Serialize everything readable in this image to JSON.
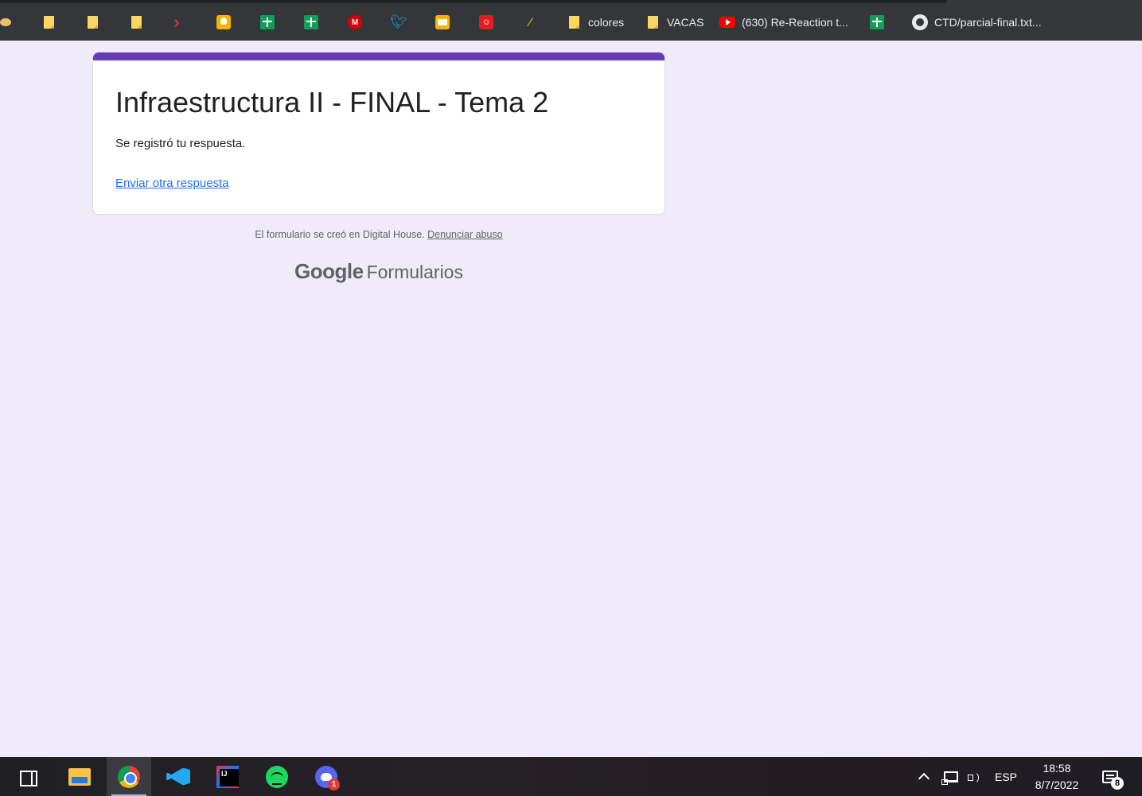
{
  "bookmarks": [
    {
      "name": "bookmark-partial",
      "icon": "sunglasses-icon",
      "label": ""
    },
    {
      "name": "bookmark-note-1",
      "icon": "note-icon",
      "label": ""
    },
    {
      "name": "bookmark-note-2",
      "icon": "note-icon",
      "label": ""
    },
    {
      "name": "bookmark-note-3",
      "icon": "note-icon",
      "label": ""
    },
    {
      "name": "bookmark-redirect",
      "icon": "red-chevron-icon",
      "label": ""
    },
    {
      "name": "bookmark-keep",
      "icon": "keep-icon",
      "label": ""
    },
    {
      "name": "bookmark-sheets-1",
      "icon": "sheets-icon",
      "label": ""
    },
    {
      "name": "bookmark-sheets-2",
      "icon": "sheets-icon",
      "label": ""
    },
    {
      "name": "bookmark-mega",
      "icon": "mega-icon",
      "label": ""
    },
    {
      "name": "bookmark-twitter",
      "icon": "twitter-icon",
      "label": ""
    },
    {
      "name": "bookmark-slides",
      "icon": "slides-icon",
      "label": ""
    },
    {
      "name": "bookmark-lastfm",
      "icon": "lastfm-icon",
      "label": ""
    },
    {
      "name": "bookmark-wand",
      "icon": "wand-icon",
      "label": ""
    },
    {
      "name": "bookmark-colores",
      "icon": "note-icon",
      "label": "colores"
    },
    {
      "name": "bookmark-vacas",
      "icon": "note-icon",
      "label": "VACAS"
    },
    {
      "name": "bookmark-youtube",
      "icon": "youtube-icon",
      "label": "(630) Re-Reaction t..."
    },
    {
      "name": "bookmark-sheets-3",
      "icon": "sheets-icon",
      "label": ""
    },
    {
      "name": "bookmark-github",
      "icon": "github-icon",
      "label": "CTD/parcial-final.txt..."
    }
  ],
  "form": {
    "title": "Infraestructura II - FINAL - Tema 2",
    "confirmation": "Se registró tu respuesta.",
    "another_response_link": "Enviar otra respuesta",
    "accent_color": "#673ab7"
  },
  "footer": {
    "created_text": "El formulario se creó en Digital House.",
    "report_abuse": "Denunciar abuso",
    "brand_google": "Google",
    "brand_product": "Formularios"
  },
  "taskbar": {
    "apps": [
      {
        "name": "task-view-button",
        "icon": "task-view-icon"
      },
      {
        "name": "file-explorer-button",
        "icon": "folder-icon"
      },
      {
        "name": "chrome-button",
        "icon": "chrome-icon",
        "active": true
      },
      {
        "name": "vscode-button",
        "icon": "vscode-icon"
      },
      {
        "name": "intellij-button",
        "icon": "intellij-icon"
      },
      {
        "name": "spotify-button",
        "icon": "spotify-icon"
      },
      {
        "name": "discord-button",
        "icon": "discord-icon",
        "badge": "1"
      }
    ],
    "tray": {
      "language": "ESP",
      "time": "18:58",
      "date": "8/7/2022",
      "notifications_count": "8"
    }
  }
}
